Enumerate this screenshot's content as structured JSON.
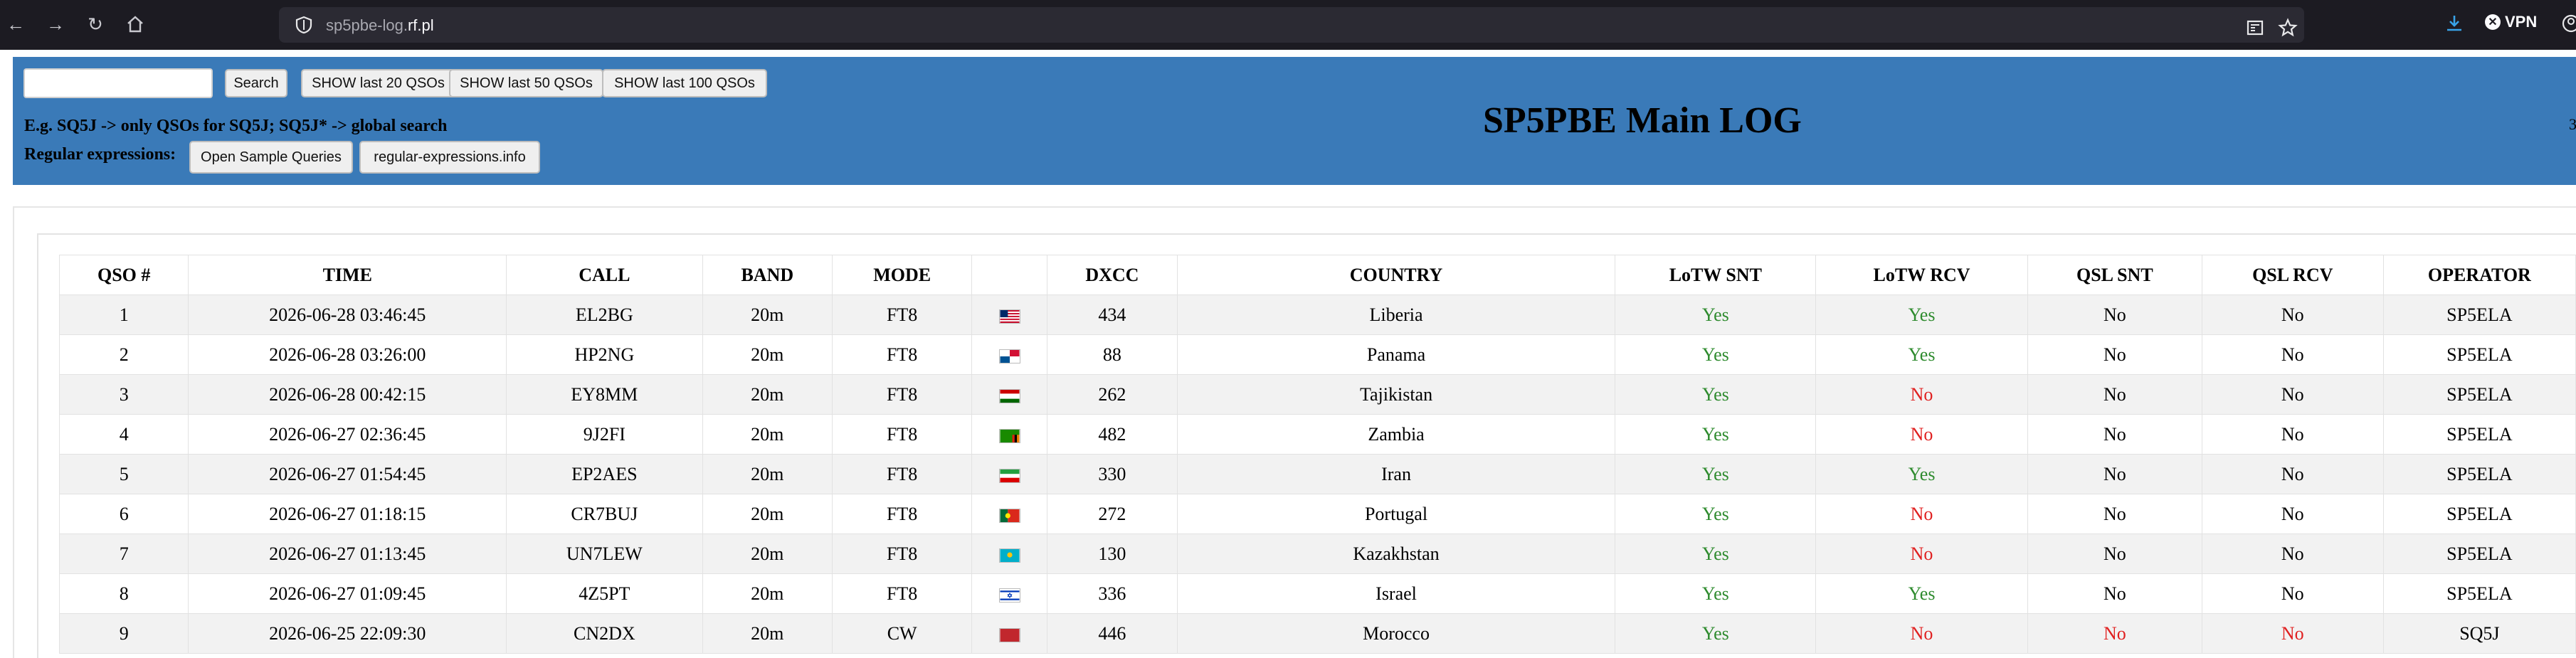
{
  "browser": {
    "url_subdomain": "sp5pbe-log.",
    "url_domain": "rf.pl",
    "vpn_label": "VPN",
    "colors": {
      "chrome_bg": "#1c1b22",
      "urlbar_bg": "#2b2a33"
    }
  },
  "header": {
    "title": "SP5PBE Main LOG",
    "search_button": "Search",
    "search_value": "",
    "show20": "SHOW last 20 QSOs",
    "show50": "SHOW last 50 QSOs",
    "show100": "SHOW last 100 QSOs",
    "hint": "E.g. SQ5J -> only QSOs for SQ5J; SQ5J* -> global search",
    "regex_label": "Regular expressions:",
    "sample_queries_button": "Open Sample Queries",
    "regex_info_button": "regular-expressions.info",
    "edge_text": "3",
    "colors": {
      "band": "#3a7ab8"
    }
  },
  "table": {
    "columns": [
      "QSO #",
      "TIME",
      "CALL",
      "BAND",
      "MODE",
      "",
      "DXCC",
      "COUNTRY",
      "LoTW SNT",
      "LoTW RCV",
      "QSL SNT",
      "QSL RCV",
      "OPERATOR"
    ],
    "rows": [
      {
        "n": "1",
        "time": "2026-06-28 03:46:45",
        "call": "EL2BG",
        "band": "20m",
        "mode": "FT8",
        "flag": "flag-liberia",
        "dxcc": "434",
        "country": "Liberia",
        "lotw_snt": "Yes",
        "lotw_rcv": "Yes",
        "qsl_snt": "No",
        "qsl_rcv": "No",
        "operator": "SP5ELA"
      },
      {
        "n": "2",
        "time": "2026-06-28 03:26:00",
        "call": "HP2NG",
        "band": "20m",
        "mode": "FT8",
        "flag": "flag-panama",
        "dxcc": "88",
        "country": "Panama",
        "lotw_snt": "Yes",
        "lotw_rcv": "Yes",
        "qsl_snt": "No",
        "qsl_rcv": "No",
        "operator": "SP5ELA"
      },
      {
        "n": "3",
        "time": "2026-06-28 00:42:15",
        "call": "EY8MM",
        "band": "20m",
        "mode": "FT8",
        "flag": "flag-tajikistan",
        "dxcc": "262",
        "country": "Tajikistan",
        "lotw_snt": "Yes",
        "lotw_rcv": "No",
        "qsl_snt": "No",
        "qsl_rcv": "No",
        "operator": "SP5ELA"
      },
      {
        "n": "4",
        "time": "2026-06-27 02:36:45",
        "call": "9J2FI",
        "band": "20m",
        "mode": "FT8",
        "flag": "flag-zambia",
        "dxcc": "482",
        "country": "Zambia",
        "lotw_snt": "Yes",
        "lotw_rcv": "No",
        "qsl_snt": "No",
        "qsl_rcv": "No",
        "operator": "SP5ELA"
      },
      {
        "n": "5",
        "time": "2026-06-27 01:54:45",
        "call": "EP2AES",
        "band": "20m",
        "mode": "FT8",
        "flag": "flag-iran",
        "dxcc": "330",
        "country": "Iran",
        "lotw_snt": "Yes",
        "lotw_rcv": "Yes",
        "qsl_snt": "No",
        "qsl_rcv": "No",
        "operator": "SP5ELA"
      },
      {
        "n": "6",
        "time": "2026-06-27 01:18:15",
        "call": "CR7BUJ",
        "band": "20m",
        "mode": "FT8",
        "flag": "flag-portugal",
        "dxcc": "272",
        "country": "Portugal",
        "lotw_snt": "Yes",
        "lotw_rcv": "No",
        "qsl_snt": "No",
        "qsl_rcv": "No",
        "operator": "SP5ELA"
      },
      {
        "n": "7",
        "time": "2026-06-27 01:13:45",
        "call": "UN7LEW",
        "band": "20m",
        "mode": "FT8",
        "flag": "flag-kazakhstan",
        "dxcc": "130",
        "country": "Kazakhstan",
        "lotw_snt": "Yes",
        "lotw_rcv": "No",
        "qsl_snt": "No",
        "qsl_rcv": "No",
        "operator": "SP5ELA"
      },
      {
        "n": "8",
        "time": "2026-06-27 01:09:45",
        "call": "4Z5PT",
        "band": "20m",
        "mode": "FT8",
        "flag": "flag-israel",
        "dxcc": "336",
        "country": "Israel",
        "lotw_snt": "Yes",
        "lotw_rcv": "Yes",
        "qsl_snt": "No",
        "qsl_rcv": "No",
        "operator": "SP5ELA"
      },
      {
        "n": "9",
        "time": "2026-06-25 22:09:30",
        "call": "CN2DX",
        "band": "20m",
        "mode": "CW",
        "flag": "flag-morocco",
        "dxcc": "446",
        "country": "Morocco",
        "lotw_snt": "Yes",
        "lotw_rcv": "No",
        "qsl_snt": "No",
        "qsl_rcv": "No",
        "operator": "SQ5J"
      }
    ],
    "colors": {
      "yes": "#2e8b2e",
      "no_red": "#e02020",
      "stripe": "#f2f2f2"
    }
  }
}
